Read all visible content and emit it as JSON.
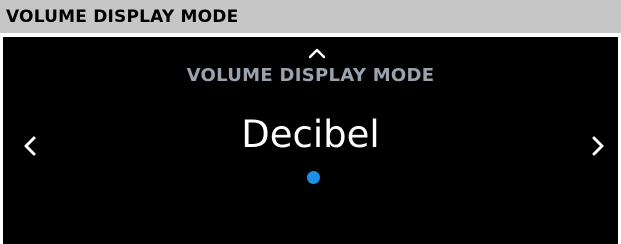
{
  "header": {
    "title": "VOLUME DISPLAY MODE"
  },
  "screen": {
    "title": "VOLUME DISPLAY MODE",
    "value": "Decibel",
    "icons": {
      "up": "chevron-up-icon",
      "left": "chevron-left-icon",
      "right": "chevron-right-icon",
      "indicator": "page-indicator-dot"
    },
    "page_indicator": {
      "current": 1,
      "total": 1
    }
  },
  "colors": {
    "header_background": "#c6c6c6",
    "screen_background": "#000000",
    "value_text": "#ffffff",
    "title_text": "#9aa3ad",
    "accent_dot": "#1a8fe3"
  }
}
